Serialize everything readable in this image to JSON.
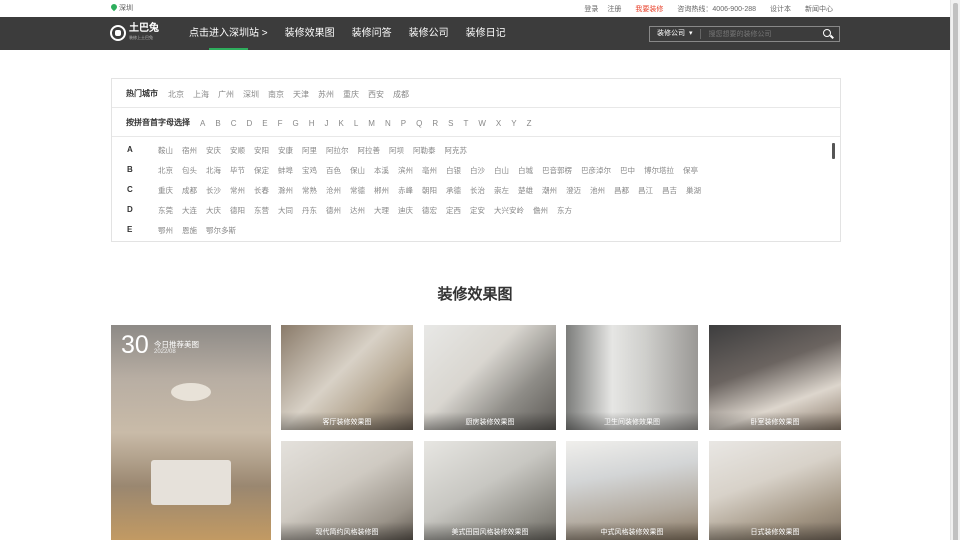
{
  "topbar": {
    "location": "深圳",
    "links": [
      "登录",
      "注册",
      "我要装修",
      "咨询热线：4006-900-288",
      "设计本",
      "新闻中心"
    ],
    "highlight_link": "我要装修"
  },
  "nav": {
    "logo_text": "土巴兔",
    "logo_sub": "装修上土巴兔",
    "items": [
      "点击进入深圳站 >",
      "装修效果图",
      "装修问答",
      "装修公司",
      "装修日记"
    ],
    "active_index": 0
  },
  "search": {
    "select_label": "装修公司",
    "placeholder": "搜您想要的装修公司"
  },
  "city_picker": {
    "hot_label": "热门城市",
    "hot_cities": [
      "北京",
      "上海",
      "广州",
      "深圳",
      "南京",
      "天津",
      "苏州",
      "重庆",
      "西安",
      "成都"
    ],
    "letter_label": "按拼音首字母选择",
    "letters": [
      "A",
      "B",
      "C",
      "D",
      "E",
      "F",
      "G",
      "H",
      "J",
      "K",
      "L",
      "M",
      "N",
      "P",
      "Q",
      "R",
      "S",
      "T",
      "W",
      "X",
      "Y",
      "Z"
    ],
    "groups": [
      {
        "key": "A",
        "cities": [
          "鞍山",
          "宿州",
          "安庆",
          "安顺",
          "安阳",
          "安康",
          "阿里",
          "阿拉尔",
          "阿拉善",
          "阿坝",
          "阿勒泰",
          "阿克苏"
        ]
      },
      {
        "key": "B",
        "cities": [
          "北京",
          "包头",
          "北海",
          "毕节",
          "保定",
          "蚌埠",
          "宝鸡",
          "百色",
          "保山",
          "本溪",
          "滨州",
          "亳州",
          "白银",
          "白沙",
          "白山",
          "白城",
          "巴音郭楞",
          "巴彦淖尔",
          "巴中",
          "博尔塔拉",
          "保亭"
        ]
      },
      {
        "key": "C",
        "cities": [
          "重庆",
          "成都",
          "长沙",
          "常州",
          "长春",
          "滁州",
          "常熟",
          "沧州",
          "常德",
          "郴州",
          "赤峰",
          "朝阳",
          "承德",
          "长治",
          "崇左",
          "楚雄",
          "潮州",
          "澄迈",
          "池州",
          "昌都",
          "昌江",
          "昌吉",
          "巢湖"
        ]
      },
      {
        "key": "D",
        "cities": [
          "东莞",
          "大连",
          "大庆",
          "德阳",
          "东营",
          "大同",
          "丹东",
          "德州",
          "达州",
          "大理",
          "迪庆",
          "德宏",
          "定西",
          "定安",
          "大兴安岭",
          "儋州",
          "东方"
        ]
      },
      {
        "key": "E",
        "cities": [
          "鄂州",
          "恩施",
          "鄂尔多斯"
        ]
      }
    ]
  },
  "section_title": "装修效果图",
  "gallery": {
    "featured": {
      "day": "30",
      "title": "今日推荐美图",
      "date": "2022/08"
    },
    "cards": [
      "客厅装修效果图",
      "厨房装修效果图",
      "卫生间装修效果图",
      "卧室装修效果图",
      "现代简约风格装修图",
      "美式田园风格装修效果图",
      "中式风格装修效果图",
      "日式装修效果图"
    ]
  },
  "colors": {
    "nav_bg": "#3c3c3c",
    "accent_green": "#2eae5d",
    "highlight_red": "#e8452f"
  }
}
